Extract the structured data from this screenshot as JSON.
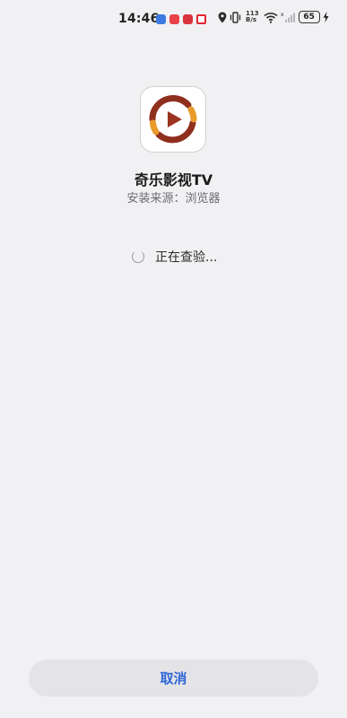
{
  "status_bar": {
    "time": "14:46",
    "net_speed_value": "113",
    "net_speed_unit": "B/s",
    "battery_level": "65",
    "icons": [
      "location-icon",
      "vibrate-icon",
      "wifi-icon",
      "signal-icon",
      "charging-icon"
    ]
  },
  "app": {
    "name": "奇乐影视TV",
    "install_source": "安装来源：浏览器",
    "icon": "play-circle-app-icon",
    "icon_colors": {
      "background": "#ffffff",
      "ring_dark": "#8f2f1d",
      "ring_orange": "#e89a2b",
      "play": "#9c3320"
    }
  },
  "status": {
    "checking_text": "正在查验..."
  },
  "actions": {
    "cancel_label": "取消",
    "accent_color": "#2e66d6"
  }
}
